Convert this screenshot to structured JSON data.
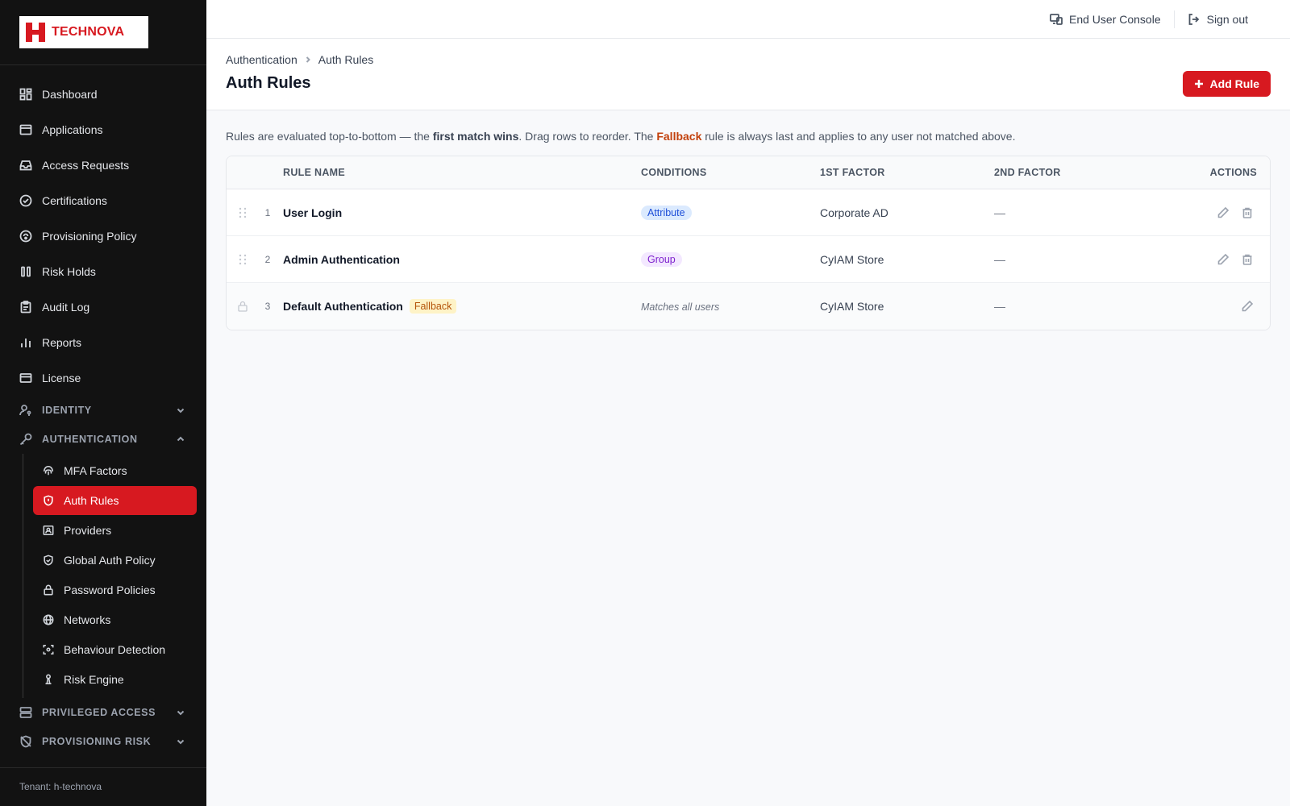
{
  "brand": {
    "name": "TECHNOVA",
    "accent": "#d71920"
  },
  "sidebar": {
    "items": [
      {
        "label": "Dashboard",
        "icon": "dashboard-icon"
      },
      {
        "label": "Applications",
        "icon": "applications-icon"
      },
      {
        "label": "Access Requests",
        "icon": "inbox-icon"
      },
      {
        "label": "Certifications",
        "icon": "check-circle-icon"
      },
      {
        "label": "Provisioning Policy",
        "icon": "policy-icon"
      },
      {
        "label": "Risk Holds",
        "icon": "pause-icon"
      },
      {
        "label": "Audit Log",
        "icon": "clipboard-icon"
      },
      {
        "label": "Reports",
        "icon": "bar-chart-icon"
      },
      {
        "label": "License",
        "icon": "card-icon"
      }
    ],
    "sections": {
      "identity": "IDENTITY",
      "authentication": "AUTHENTICATION",
      "privileged": "PRIVILEGED ACCESS",
      "provisioning_risk": "PROVISIONING RISK"
    },
    "auth_items": [
      {
        "label": "MFA Factors"
      },
      {
        "label": "Auth Rules"
      },
      {
        "label": "Providers"
      },
      {
        "label": "Global Auth Policy"
      },
      {
        "label": "Password Policies"
      },
      {
        "label": "Networks"
      },
      {
        "label": "Behaviour Detection"
      },
      {
        "label": "Risk Engine"
      }
    ],
    "footer": "Tenant: h-technova"
  },
  "topbar": {
    "console": "End User Console",
    "signout": "Sign out"
  },
  "header": {
    "breadcrumb": [
      "Authentication",
      "Auth Rules"
    ],
    "title": "Auth Rules",
    "add_button": "Add Rule"
  },
  "intro": {
    "part1": "Rules are evaluated top-to-bottom — the ",
    "bold": "first match wins",
    "part2": ". Drag rows to reorder. The ",
    "fallback": "Fallback",
    "part3": " rule is always last and applies to any user not matched above."
  },
  "table": {
    "headers": {
      "name": "RULE NAME",
      "conditions": "CONDITIONS",
      "f1": "1ST FACTOR",
      "f2": "2ND FACTOR",
      "actions": "ACTIONS"
    },
    "rows": [
      {
        "num": "1",
        "name": "User Login",
        "condition": "Attribute",
        "f1": "Corporate AD",
        "f2": "—"
      },
      {
        "num": "2",
        "name": "Admin Authentication",
        "condition": "Group",
        "f1": "CyIAM Store",
        "f2": "—"
      },
      {
        "num": "3",
        "name": "Default Authentication",
        "badge": "Fallback",
        "condition": "Matches all users",
        "f1": "CyIAM Store",
        "f2": "—"
      }
    ]
  }
}
